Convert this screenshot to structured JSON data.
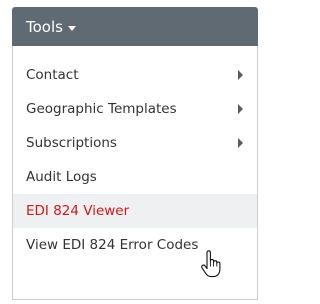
{
  "menu": {
    "title": "Tools",
    "caret_icon": "caret-down-icon",
    "background_color": "#5f6a73",
    "items": [
      {
        "label": "Contact",
        "has_submenu": true
      },
      {
        "label": "Geographic Templates",
        "has_submenu": true
      },
      {
        "label": "Subscriptions",
        "has_submenu": true
      },
      {
        "label": "Audit Logs",
        "has_submenu": false
      },
      {
        "label": "EDI 824 Viewer",
        "has_submenu": false,
        "hovered": true
      },
      {
        "label": "View EDI 824 Error Codes",
        "has_submenu": false
      }
    ],
    "hover_text_color": "#d11a1a",
    "cursor_icon": "hand-pointer-icon"
  }
}
